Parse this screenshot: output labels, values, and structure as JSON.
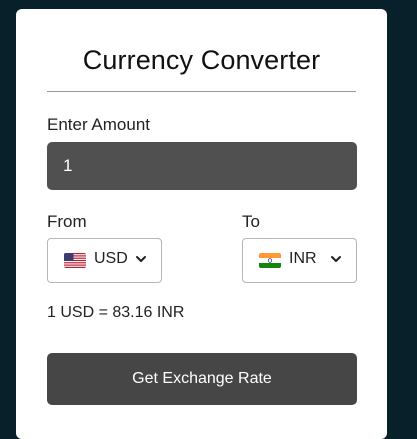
{
  "title": "Currency Converter",
  "amount": {
    "label": "Enter Amount",
    "value": "1"
  },
  "from": {
    "label": "From",
    "currency": "USD",
    "flag_icon": "us-flag-icon"
  },
  "to": {
    "label": "To",
    "currency": "INR",
    "flag_icon": "india-flag-icon"
  },
  "result": "1 USD = 83.16 INR",
  "button_label": "Get Exchange Rate",
  "colors": {
    "background": "#082029",
    "card": "#ffffff",
    "input_bg": "#505050",
    "button_bg": "#464646"
  }
}
